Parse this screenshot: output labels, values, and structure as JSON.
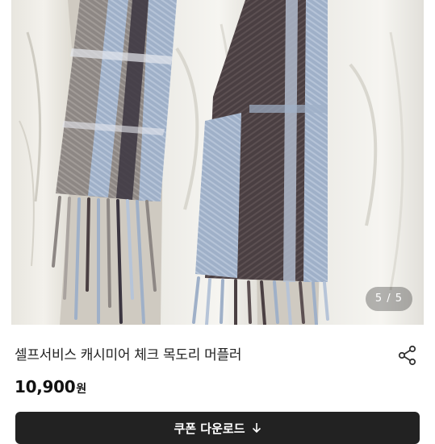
{
  "image": {
    "counter": "5 / 5"
  },
  "product": {
    "title": "셀프서비스 캐시미어 체크 목도리 머플러",
    "price": "10,900",
    "unit": "원"
  },
  "actions": {
    "share_icon": "share-icon",
    "coupon_label": "쿠폰 다운로드",
    "download_icon": "download-arrow-icon"
  }
}
